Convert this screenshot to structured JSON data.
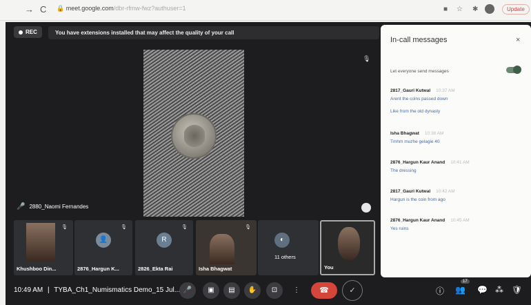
{
  "browser": {
    "back": "→",
    "reload": "C",
    "url_host": "meet.google.com",
    "url_path": "/dbr-rfmw-fwz?authuser=1",
    "update_label": "Update"
  },
  "meet": {
    "rec_label": "REC",
    "banner": "You have extensions installed that may affect the quality of your call",
    "speaker_name": "2880_Naomi Fernandes",
    "tiles": [
      {
        "label": "Khushboo Din..."
      },
      {
        "label": "2876_Hargun K..."
      },
      {
        "label": "2826_Ekta Rai",
        "initial": "R"
      },
      {
        "label": "Isha Bhagwat"
      },
      {
        "label": "11 others"
      },
      {
        "label": "You"
      }
    ],
    "bottom": {
      "time": "10:49 AM",
      "separator": "|",
      "meeting_name": "TYBA_Ch1_Numismatics Demo_15 Jul...",
      "people_count": "17"
    }
  },
  "chat": {
    "title": "In-call messages",
    "close": "×",
    "toggle_label": "Let everyone send messages",
    "toggle_on": true,
    "messages": [
      {
        "sender": "2817_Gauri Kutwal",
        "time": "10:37 AM",
        "lines": [
          "Arent the coins passed down",
          "Like from the old dynasty"
        ]
      },
      {
        "sender": "Isha Bhagwat",
        "time": "10:38 AM",
        "lines": [
          "Tmhm muzhe gelagie 40"
        ]
      },
      {
        "sender": "2876_Hargun Kaur Anand",
        "time": "10:41 AM",
        "lines": [
          "The dressing"
        ]
      },
      {
        "sender": "2817_Gauri Kutwal",
        "time": "10:42 AM",
        "lines": [
          "Hargun is the coin from ago"
        ]
      },
      {
        "sender": "2876_Hargun Kaur Anand",
        "time": "10:45 AM",
        "lines": [
          "Yes ruins"
        ]
      }
    ]
  },
  "colors": {
    "meet_bg": "#1d1d1f",
    "end_call": "#d4453a",
    "chat_link": "#4a6a9a"
  }
}
